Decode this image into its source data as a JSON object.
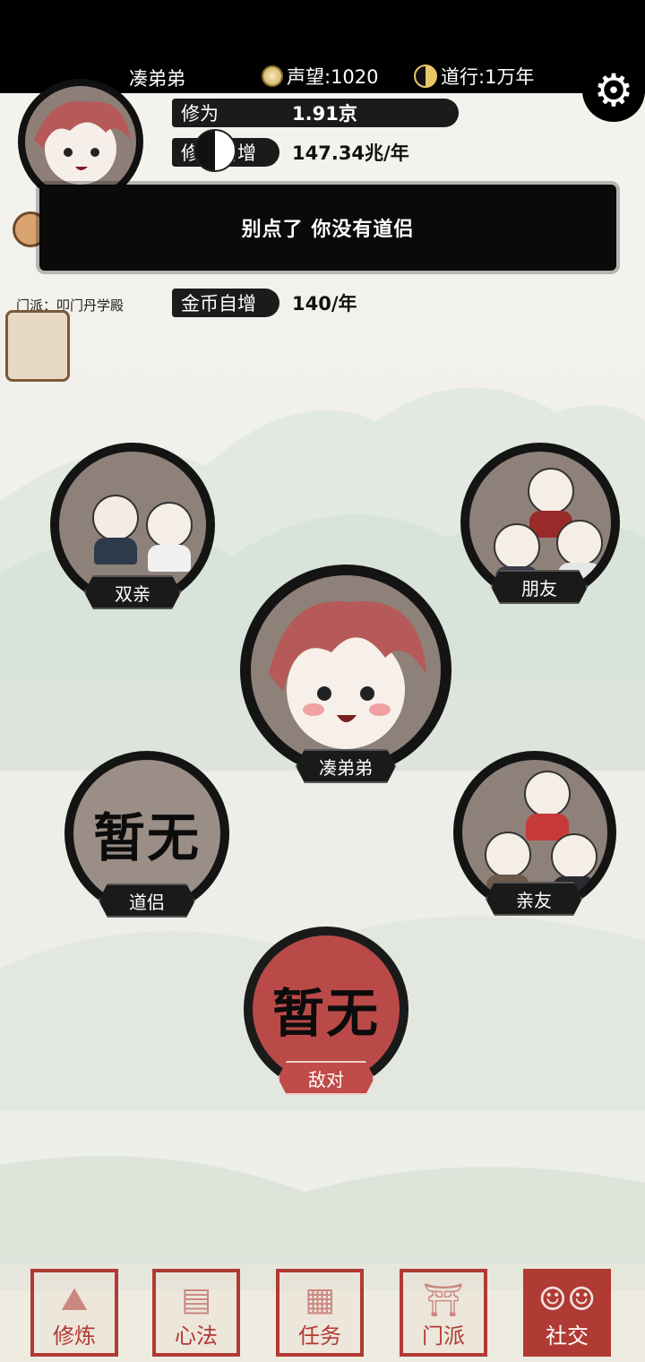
{
  "header": {
    "player_name": "凑弟弟",
    "prestige": "声望:1020",
    "dao": "道行:1万年",
    "settings_icon": "gear-icon",
    "prestige_icon": "coin-icon",
    "dao_icon": "yinyang-icon"
  },
  "profile": {
    "sect": "门派：叩门丹学殿"
  },
  "stats": [
    {
      "label": "修为",
      "value": "1.91京"
    },
    {
      "label": "修为自增",
      "value": "147.34兆/年"
    },
    {
      "label": "金币自增",
      "value": "140/年"
    }
  ],
  "toast": {
    "message": "别点了 你没有道侣"
  },
  "relations": {
    "parents": {
      "label": "双亲"
    },
    "friends": {
      "label": "朋友"
    },
    "self": {
      "label": "凑弟弟"
    },
    "partner": {
      "label": "道侣",
      "empty_text": "暂无"
    },
    "relatives": {
      "label": "亲友"
    },
    "enemy": {
      "label": "敌对",
      "empty_text": "暂无"
    }
  },
  "nav": [
    {
      "label": "修炼",
      "icon": "mountain-icon"
    },
    {
      "label": "心法",
      "icon": "scroll-icon"
    },
    {
      "label": "任务",
      "icon": "paper-icon"
    },
    {
      "label": "门派",
      "icon": "gate-icon"
    },
    {
      "label": "社交",
      "icon": "people-icon",
      "active": true
    }
  ],
  "colors": {
    "seal_red": "#b03a34",
    "ink": "#141414",
    "circle_fill": "#8e8179"
  }
}
